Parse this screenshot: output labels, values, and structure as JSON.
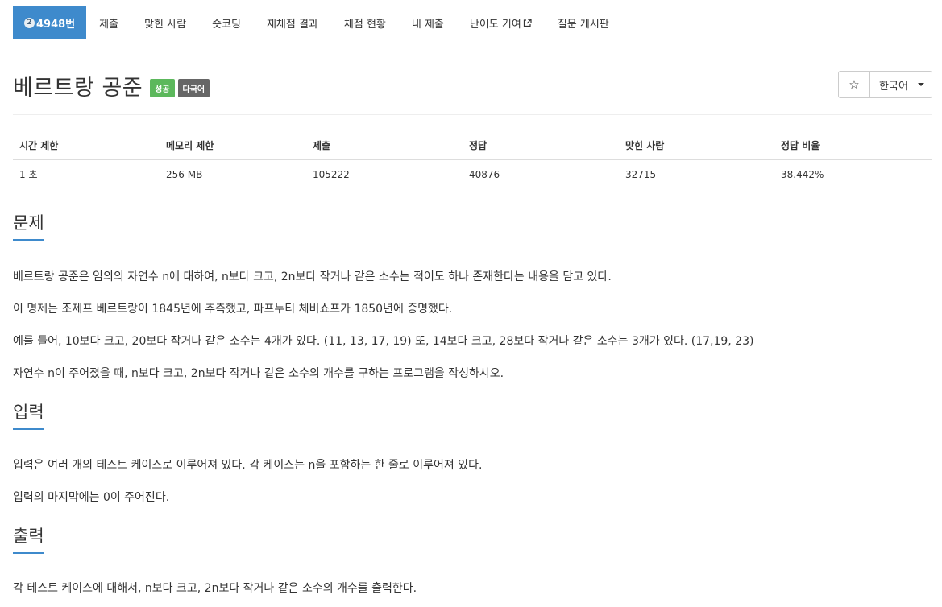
{
  "nav": {
    "problem_id": "4948번",
    "tier_badge": "2",
    "items": [
      "제출",
      "맞힌 사람",
      "숏코딩",
      "재채점 결과",
      "채점 현황",
      "내 제출",
      "난이도 기여",
      "질문 게시판"
    ]
  },
  "title": {
    "text": "베르트랑 공준",
    "status_label": "성공",
    "lang_label": "다국어"
  },
  "buttons": {
    "star": "☆",
    "language": "한국어"
  },
  "stats": {
    "headers": [
      "시간 제한",
      "메모리 제한",
      "제출",
      "정답",
      "맞힌 사람",
      "정답 비율"
    ],
    "values": [
      "1 초",
      "256 MB",
      "105222",
      "40876",
      "32715",
      "38.442%"
    ]
  },
  "sections": {
    "problem": {
      "heading": "문제",
      "paragraphs": [
        "베르트랑 공준은 임의의 자연수 n에 대하여, n보다 크고, 2n보다 작거나 같은 소수는 적어도 하나 존재한다는 내용을 담고 있다.",
        "이 명제는 조제프 베르트랑이 1845년에 추측했고, 파프누티 체비쇼프가 1850년에 증명했다.",
        "예를 들어, 10보다 크고, 20보다 작거나 같은 소수는 4개가 있다. (11, 13, 17, 19) 또, 14보다 크고, 28보다 작거나 같은 소수는 3개가 있다. (17,19, 23)",
        "자연수 n이 주어졌을 때, n보다 크고, 2n보다 작거나 같은 소수의 개수를 구하는 프로그램을 작성하시오."
      ]
    },
    "input": {
      "heading": "입력",
      "paragraphs": [
        "입력은 여러 개의 테스트 케이스로 이루어져 있다. 각 케이스는 n을 포함하는 한 줄로 이루어져 있다.",
        "입력의 마지막에는 0이 주어진다."
      ]
    },
    "output": {
      "heading": "출력",
      "paragraphs": [
        "각 테스트 케이스에 대해서, n보다 크고, 2n보다 작거나 같은 소수의 개수를 출력한다."
      ]
    }
  },
  "colors": {
    "accent": "#3e8acc",
    "success": "#5cb85c",
    "lang_label": "#666666"
  }
}
